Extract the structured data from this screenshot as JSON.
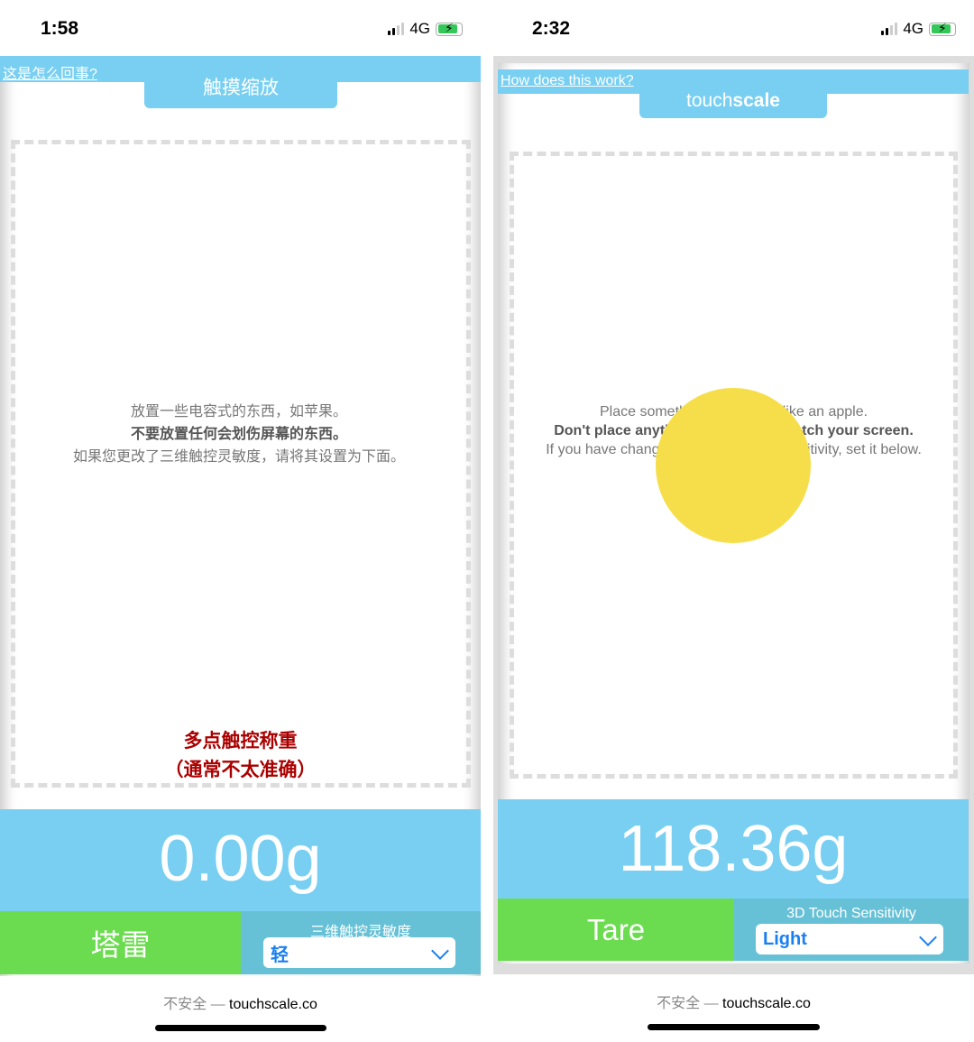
{
  "left_phone": {
    "status_time": "1:58",
    "network": "4G",
    "help_link": "这是怎么回事?",
    "title": "触摸缩放",
    "instructions": [
      "放置一些电容式的东西，如苹果。",
      "不要放置任何会划伤屏幕的东西。",
      "如果您更改了三维触控灵敏度，请将其设置为下面。"
    ],
    "multitouch_note": [
      "多点触控称重",
      "（通常不太准确）"
    ],
    "weight": "0.00g",
    "tare_label": "塔雷",
    "sensitivity_label": "三维触控灵敏度",
    "sensitivity_value": "轻",
    "url_insecure": "不安全 —",
    "url": "touchscale.co"
  },
  "right_phone": {
    "status_time": "2:32",
    "network": "4G",
    "help_link": "How does this work?",
    "title_light": "touch",
    "title_bold": "scale",
    "instructions": [
      "Place something capacitive, like an apple.",
      "Don't place anything that could scratch your screen.",
      "If you have changed your 3D Touch sensitivity, set it below."
    ],
    "weight": "118.36g",
    "tare_label": "Tare",
    "sensitivity_label": "3D Touch Sensitivity",
    "sensitivity_value": "Light",
    "url_insecure": "不安全 —",
    "url": "touchscale.co",
    "touch_indicator_color": "#f6de4a"
  },
  "colors": {
    "header_blue": "#78cff2",
    "tare_green": "#6bdc4f",
    "sensitivity_teal": "#66c1d6",
    "warning_red": "#aa0000"
  }
}
